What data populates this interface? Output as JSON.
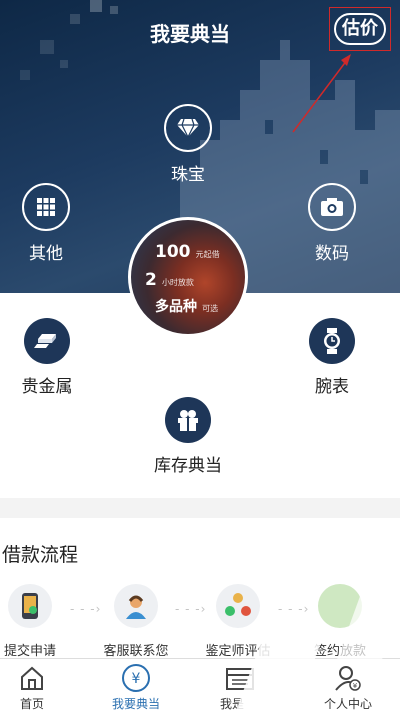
{
  "header": {
    "title": "我要典当",
    "estimate_button": "估价"
  },
  "categories": {
    "jewelry": {
      "label": "珠宝",
      "icon": "diamond-icon"
    },
    "other": {
      "label": "其他",
      "icon": "grid-icon"
    },
    "digital": {
      "label": "数码",
      "icon": "camera-icon"
    },
    "precious_metal": {
      "label": "贵金属",
      "icon": "gold-bar-icon"
    },
    "watch": {
      "label": "腕表",
      "icon": "watch-icon"
    },
    "inventory": {
      "label": "库存典当",
      "icon": "box-icon"
    }
  },
  "promo": {
    "line1_value": "100",
    "line1_unit": "元起借",
    "line2_value": "2",
    "line2_unit": "小时放款",
    "line3_value": "多品种",
    "line3_unit": "可选"
  },
  "loan_flow": {
    "title": "借款流程",
    "steps": [
      {
        "label": "提交申请",
        "icon": "phone-icon"
      },
      {
        "label": "客服联系您",
        "icon": "customer-service-icon"
      },
      {
        "label": "鉴定师评估",
        "icon": "appraisal-icon"
      },
      {
        "label": "签约放款",
        "icon": "contract-icon"
      }
    ]
  },
  "tabbar": {
    "tabs": [
      {
        "label": "首页",
        "icon": "home-icon"
      },
      {
        "label": "我要典当",
        "icon": "yen-circle-icon"
      },
      {
        "label": "我是",
        "icon": "calendar-icon"
      },
      {
        "label": "个人中心",
        "icon": "user-icon"
      }
    ]
  },
  "colors": {
    "hero": "#1d3b60",
    "accent": "#2a6fb0",
    "annotation": "#d02a2a"
  }
}
